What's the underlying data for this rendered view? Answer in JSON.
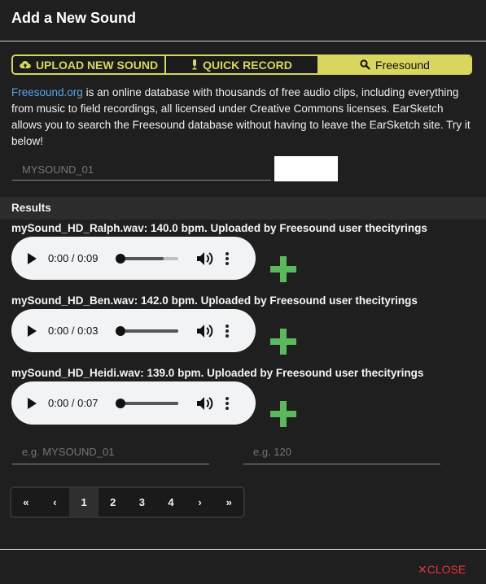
{
  "dialog": {
    "title": "Add a New Sound"
  },
  "tabs": [
    {
      "label": "UPLOAD NEW SOUND",
      "icon": "cloud-upload-icon",
      "active": false
    },
    {
      "label": "QUICK RECORD",
      "icon": "microphone-icon",
      "active": false
    },
    {
      "label": "Freesound",
      "icon": "search-icon",
      "active": true
    }
  ],
  "description": {
    "link_text": "Freesound.org",
    "text": " is an online database with thousands of free audio clips, including everything from music to field recordings, all licensed under Creative Commons licenses. EarSketch allows you to search the Freesound database without having to leave the EarSketch site. Try it below!"
  },
  "search": {
    "placeholder": "MYSOUND_01"
  },
  "results": {
    "header": "Results",
    "items": [
      {
        "label": "mySound_HD_Ralph.wav: 140.0 bpm. Uploaded by Freesound user thecityrings",
        "time": "0:00 / 0:09",
        "progress": 0.75
      },
      {
        "label": "mySound_HD_Ben.wav: 142.0 bpm. Uploaded by Freesound user thecityrings",
        "time": "0:00 / 0:03",
        "progress": 1.0
      },
      {
        "label": "mySound_HD_Heidi.wav: 139.0 bpm. Uploaded by Freesound user thecityrings",
        "time": "0:00 / 0:07",
        "progress": 1.0
      }
    ]
  },
  "form": {
    "name_placeholder": "e.g. MYSOUND_01",
    "tempo_placeholder": "e.g. 120"
  },
  "pagination": {
    "first": "«",
    "prev": "‹",
    "pages": [
      "1",
      "2",
      "3",
      "4"
    ],
    "current": "1",
    "next": "›",
    "last": "»"
  },
  "footer": {
    "close_label": "CLOSE",
    "close_icon": "✕"
  },
  "colors": {
    "accent": "#d8d65e",
    "link": "#5aa4e8",
    "add": "#5cb85c",
    "close": "#e4343c"
  }
}
